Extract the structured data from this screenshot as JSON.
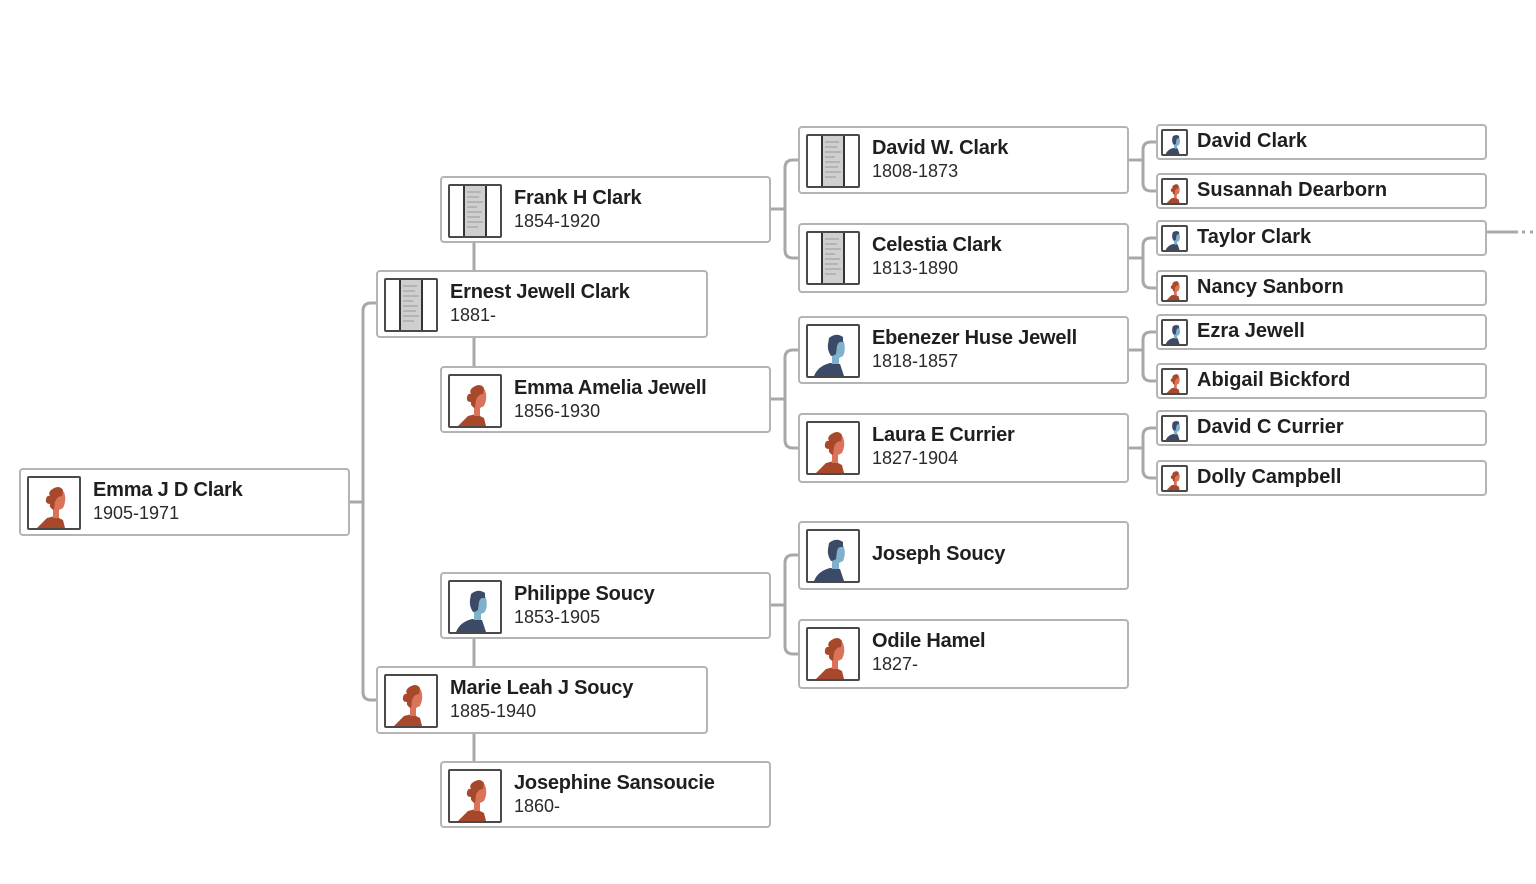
{
  "colors": {
    "male_dark": "#3b4a66",
    "male_light": "#7fb0cc",
    "female_dark": "#a8482b",
    "female_light": "#d9735a",
    "line": "#a8a8a8",
    "border": "#b4b4b4"
  },
  "tree": {
    "root": {
      "name": "Emma J D Clark",
      "dates": "1905-1971",
      "avatar": "female-silhouette"
    },
    "father": {
      "name": "Ernest Jewell Clark",
      "dates": "1881-",
      "avatar": "document-record"
    },
    "mother": {
      "name": "Marie Leah J Soucy",
      "dates": "1885-1940",
      "avatar": "female-silhouette"
    },
    "paternal_grandfather": {
      "name": "Frank H Clark",
      "dates": "1854-1920",
      "avatar": "document-record"
    },
    "paternal_grandmother": {
      "name": "Emma Amelia Jewell",
      "dates": "1856-1930",
      "avatar": "female-silhouette"
    },
    "maternal_grandfather": {
      "name": "Philippe Soucy",
      "dates": "1853-1905",
      "avatar": "male-silhouette"
    },
    "maternal_grandmother": {
      "name": "Josephine Sansoucie",
      "dates": "1860-",
      "avatar": "female-silhouette"
    },
    "gen3": [
      {
        "name": "David W. Clark",
        "dates": "1808-1873",
        "avatar": "document-record"
      },
      {
        "name": "Celestia Clark",
        "dates": "1813-1890",
        "avatar": "document-record"
      },
      {
        "name": "Ebenezer Huse Jewell",
        "dates": "1818-1857",
        "avatar": "male-silhouette"
      },
      {
        "name": "Laura E Currier",
        "dates": "1827-1904",
        "avatar": "female-silhouette"
      },
      {
        "name": "Joseph Soucy",
        "dates": "",
        "avatar": "male-silhouette"
      },
      {
        "name": "Odile Hamel",
        "dates": "1827-",
        "avatar": "female-silhouette"
      }
    ],
    "gen4": [
      {
        "name": "David Clark",
        "avatar": "male-silhouette"
      },
      {
        "name": "Susannah Dearborn",
        "avatar": "female-silhouette"
      },
      {
        "name": "Taylor Clark",
        "avatar": "male-silhouette",
        "has_more_ancestors": true
      },
      {
        "name": "Nancy Sanborn",
        "avatar": "female-silhouette"
      },
      {
        "name": "Ezra Jewell",
        "avatar": "male-silhouette"
      },
      {
        "name": "Abigail Bickford",
        "avatar": "female-silhouette"
      },
      {
        "name": "David C Currier",
        "avatar": "male-silhouette"
      },
      {
        "name": "Dolly Campbell",
        "avatar": "female-silhouette"
      }
    ]
  }
}
